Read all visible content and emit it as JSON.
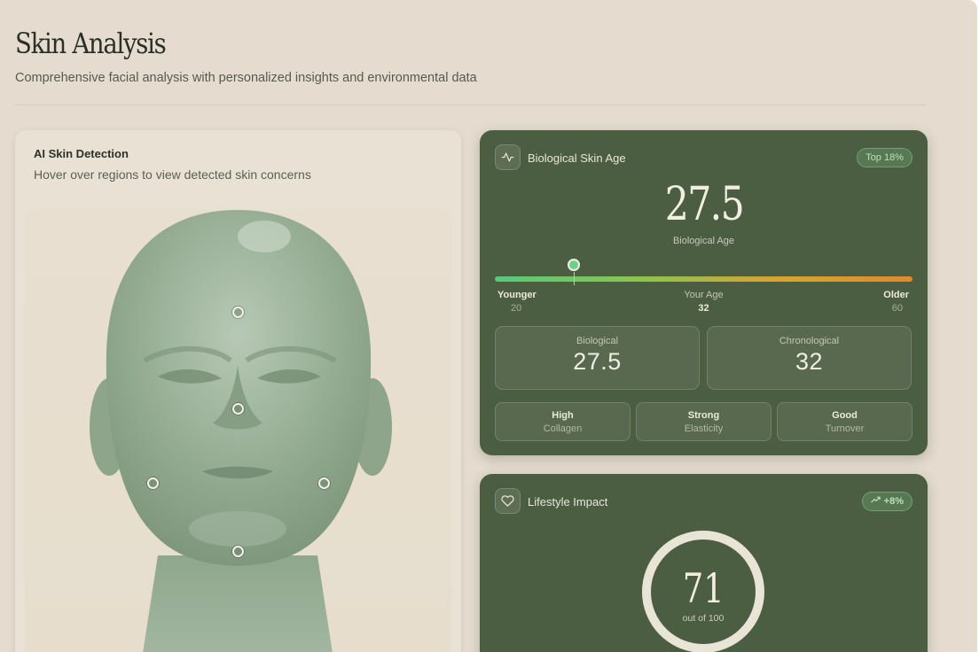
{
  "header": {
    "title": "Skin Analysis",
    "subtitle": "Comprehensive facial analysis with personalized insights and environmental data"
  },
  "detection": {
    "title": "AI Skin Detection",
    "subtitle": "Hover over regions to view detected skin concerns"
  },
  "bio_age": {
    "title": "Biological Skin Age",
    "badge": "Top 18%",
    "value": "27.5",
    "value_label": "Biological Age",
    "slider_fraction": 0.19,
    "scale": {
      "left_label": "Younger",
      "left_value": "20",
      "mid_label": "Your Age",
      "mid_value": "32",
      "right_label": "Older",
      "right_value": "60"
    },
    "stats": [
      {
        "label": "Biological",
        "value": "27.5"
      },
      {
        "label": "Chronological",
        "value": "32"
      }
    ],
    "chips": [
      {
        "strong": "High",
        "sub": "Collagen"
      },
      {
        "strong": "Strong",
        "sub": "Elasticity"
      },
      {
        "strong": "Good",
        "sub": "Turnover"
      }
    ]
  },
  "lifestyle": {
    "title": "Lifestyle Impact",
    "badge": "+8%",
    "score": "71",
    "score_sub": "out of 100"
  },
  "icons": [
    "activity-icon",
    "heart-icon",
    "trending-up-icon"
  ],
  "colors": {
    "background": "#e5dccf",
    "card_dark": "#4c5e42",
    "accent_green": "#6dcf8a",
    "accent_orange": "#e2872a"
  }
}
